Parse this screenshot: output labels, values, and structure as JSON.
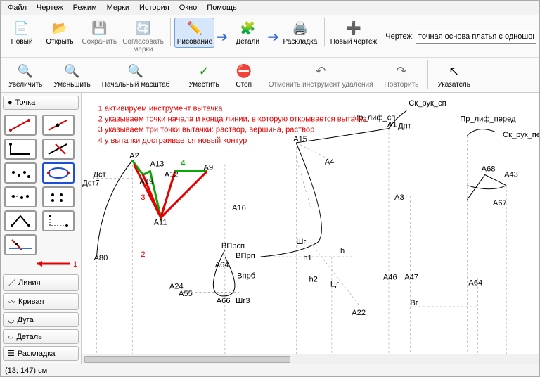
{
  "menu": [
    "Файл",
    "Чертеж",
    "Режим",
    "Мерки",
    "История",
    "Окно",
    "Помощь"
  ],
  "tb1": {
    "new": "Новый",
    "open": "Открыть",
    "save": "Сохранить",
    "sogl": "Согласовать\nмерки",
    "draw": "Рисование",
    "detail": "Детали",
    "layout": "Раскладка",
    "newdrw": "Новый чертеж",
    "field_lbl": "Чертеж:",
    "field_val": "точная основа платья с одношовным рука"
  },
  "tb2": {
    "zoom_in": "Увеличить",
    "zoom_out": "Уменьшить",
    "zoom_reset": "Начальный масштаб",
    "fit": "Уместить",
    "stop": "Стоп",
    "undo_del": "Отменить инструмент удаления",
    "redo": "Повторить",
    "pointer": "Указатель"
  },
  "side": {
    "point": "Точка",
    "line": "Линия",
    "curve": "Кривая",
    "arc": "Дуга",
    "detail": "Деталь",
    "layout": "Раскладка"
  },
  "notes": [
    "1 активируем инструмент вытачка",
    "2 указываем точки начала и конца линии, в которую открывается вытачка",
    "3 указываем три точки вытачки: раствор, вершина, раствор",
    "4 у вытачки достраивается новый контур"
  ],
  "arrow_labels": {
    "one": "1",
    "two": "2",
    "three": "3",
    "four": "4"
  },
  "pts": {
    "sk_ruk_sp": "Ск_рук_сп",
    "pr_lif_sp": "Пр_лиф_сп",
    "pr_lif_pered": "Пр_лиф_перед",
    "sk_ruk_per": "Ск_рук_пер",
    "dst": "Дст",
    "dst7": "Дст7",
    "dpt": "Дпт",
    "a2": "А2",
    "a13": "А13",
    "a9": "А9",
    "a19": "А19",
    "a12": "А12",
    "a11": "А11",
    "a15": "А15",
    "a1": "А1",
    "a4": "А4",
    "a3": "А3",
    "a80": "А80",
    "a24": "А24",
    "a16": "А16",
    "a55": "А55",
    "a66": "А66",
    "a64": "А64",
    "shr3": "Шг3",
    "vprb": "Впрб",
    "vprp": "ВПрп",
    "vprsp": "ВПрсп",
    "h1": "h1",
    "h2": "h2",
    "h": "h",
    "shr": "Шг",
    "cg": "Цг",
    "a46": "А46",
    "a47": "А47",
    "vg": "Вг",
    "a22": "А22",
    "a43": "А43",
    "a68": "А68",
    "a67": "А67",
    "a64_2": "А64"
  },
  "status": "(13; 147) см"
}
